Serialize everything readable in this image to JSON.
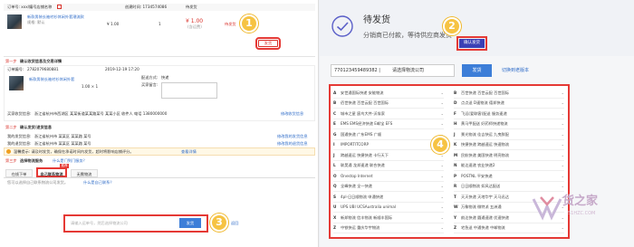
{
  "left": {
    "header": {
      "order_info": "订单号: xxx/编号店铺名称",
      "create_time": "创建时间: 1734574086",
      "status_label": "待发货",
      "status_sub": "买家已付款"
    },
    "product": {
      "title": "新款男装长袖衬衫休闲外套潮流款",
      "sub": "规格: 默认",
      "unit_price": "¥ 1.00",
      "qty": "1",
      "total": "¥ 1.00",
      "total_sub": "(含运费)",
      "status": "待发货",
      "ship_btn": "发货"
    },
    "step1": {
      "label": "第一步",
      "title": "确认收货信息及交易详情",
      "order_no_label": "订单编号:",
      "order_no": "2782079680881",
      "order_time": "2019-12-19 17:20",
      "item_title": "新款男装长袖衬衫休闲外套",
      "item_qty": "1.00 × 1",
      "delivery_label": "配送方式:",
      "delivery_val": "快递",
      "note_label": "买家留言:",
      "addr_label": "买家收货信息:",
      "addr_val": "浙江省杭州市西湖区 某某街道某某路某号 某某小区 收件人 电话 1380000000",
      "addr_btn": "修改收货信息"
    },
    "step2": {
      "label": "第二步",
      "title": "确认发货/退货信息",
      "ship_from_label": "我的发货信息:",
      "ship_from": "浙江省杭州市 某某区 某某路 某号",
      "return_label": "我的退货信息:",
      "return_val": "浙江省杭州市 某某区 某某路 某号",
      "edit1": "修改我的发货信息",
      "edit2": "修改我的退货信息",
      "notice": "温馨提示: 请及时发货，确保在承诺时间内发货，超时将影响店铺评分。",
      "notice_link": "查看详情"
    },
    "step3": {
      "label": "第三步",
      "title": "选择物流服务",
      "sub": "什么是门到门服务？",
      "tabs": [
        "在线下单",
        "自己联系物流",
        "无需物流"
      ],
      "tab_badge": "推荐",
      "logistics_hint": "您可以选择自己联系物流公司发货。",
      "faq": "什么是自己联系？",
      "input_placeholder": "请输入运单号，然后选择物流公司",
      "confirm_btn": "发货",
      "extra": "返回"
    }
  },
  "right": {
    "status_title": "待发货",
    "status_desc": "分销商已付款，等待供应商发货",
    "confirm_ship_btn": "确认发货",
    "tracking_input": "770123459489382 |",
    "tracking_placeholder": "请选择物流公司",
    "ship_btn": "发货",
    "switch_link": "切换到老版本",
    "carriers_left": [
      {
        "key": "A",
        "name": "安世通国际快递 安能物流"
      },
      {
        "key": "B",
        "name": "佰世快递 百世云配 百世国际"
      },
      {
        "key": "C",
        "name": "城市之星 宸鸟大件-沃埃家"
      },
      {
        "key": "E",
        "name": "EMS EMS经济快递 E邮宝 EFS"
      },
      {
        "key": "G",
        "name": "国通快递 广东EMS 广顺"
      },
      {
        "key": "I",
        "name": "IMPORTITCORP"
      },
      {
        "key": "J",
        "name": "跨越速运 快捷快递 卡行天下"
      },
      {
        "key": "L",
        "name": "联昊通 龙邦速递 联合快递"
      },
      {
        "key": "O",
        "name": "Onestop Internet"
      },
      {
        "key": "Q",
        "name": "全峰快递 全一快递"
      },
      {
        "key": "S",
        "name": "4pl-日日顺物流 申通快递"
      },
      {
        "key": "U",
        "name": "UPS UBI UCSAustralia unimal"
      },
      {
        "key": "X",
        "name": "新邦物流 信丰物流 新顺丰国际"
      },
      {
        "key": "Z",
        "name": "中铁快运 重庆华宇物流"
      }
    ],
    "carriers_right": [
      {
        "key": "B",
        "name": "百世快递 百世云配 百世国际"
      },
      {
        "key": "D",
        "name": "点点送 D速物流 德邦快递"
      },
      {
        "key": "F",
        "name": "飞远(爱联客)配送 服务速递"
      },
      {
        "key": "H",
        "name": "黄马甲配送 好药师快递物流"
      },
      {
        "key": "J",
        "name": "景光物流 佳吉快运 九曳鲜配"
      },
      {
        "key": "K",
        "name": "快捷快递 跨越速运 快速物流"
      },
      {
        "key": "M",
        "name": "民航快递 美国快递 明亮物流"
      },
      {
        "key": "N",
        "name": "能达速递 农业快递2"
      },
      {
        "key": "P",
        "name": "POSTNL 平安快递"
      },
      {
        "key": "R",
        "name": "日日顺物流 如风达配送"
      },
      {
        "key": "T",
        "name": "天天快递 天地华宇 天马迅达"
      },
      {
        "key": "W",
        "name": "万象物流 微特派 五洲通"
      },
      {
        "key": "Y",
        "name": "韵达快递 圆通速递 优速快递"
      },
      {
        "key": "Z",
        "name": "宅急送 中通快递 中邮物流"
      }
    ]
  },
  "badges": [
    "1",
    "2",
    "3",
    "4"
  ],
  "watermark": {
    "brand": "货之家",
    "url": "51HZC.COM"
  }
}
